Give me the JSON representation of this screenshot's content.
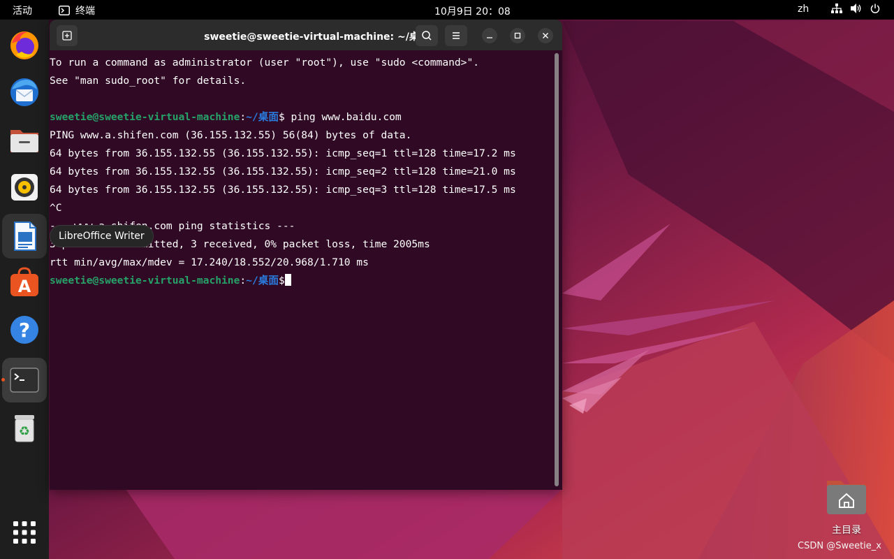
{
  "topbar": {
    "activities": "活动",
    "app_name": "终端",
    "clock": "10月9日  20：08",
    "lang": "zh"
  },
  "dock": {
    "items": [
      {
        "name": "firefox",
        "icon": "firefox-icon"
      },
      {
        "name": "thunderbird",
        "icon": "thunderbird-icon"
      },
      {
        "name": "files",
        "icon": "files-icon"
      },
      {
        "name": "rhythmbox",
        "icon": "rhythmbox-icon"
      },
      {
        "name": "libreoffice-writer",
        "icon": "writer-icon"
      },
      {
        "name": "app-center",
        "icon": "app-center-icon"
      },
      {
        "name": "help",
        "icon": "help-icon"
      },
      {
        "name": "terminal",
        "icon": "terminal-icon",
        "running": true
      },
      {
        "name": "trash",
        "icon": "trash-icon"
      },
      {
        "name": "show-apps",
        "icon": "app-grid-icon"
      }
    ]
  },
  "tooltip": "LibreOffice Writer",
  "terminal": {
    "title": "sweetie@sweetie-virtual-machine: ~/桌面",
    "lines": {
      "l1": "To run a command as administrator (user \"root\"), use \"sudo <command>\".",
      "l2": "See \"man sudo_root\" for details.",
      "prompt_user": "sweetie@sweetie-virtual-machine",
      "prompt_path": "~/桌面",
      "cmd1": " ping www.baidu.com",
      "l4": "PING www.a.shifen.com (36.155.132.55) 56(84) bytes of data.",
      "l5": "64 bytes from 36.155.132.55 (36.155.132.55): icmp_seq=1 ttl=128 time=17.2 ms",
      "l6": "64 bytes from 36.155.132.55 (36.155.132.55): icmp_seq=2 ttl=128 time=21.0 ms",
      "l7": "64 bytes from 36.155.132.55 (36.155.132.55): icmp_seq=3 ttl=128 time=17.5 ms",
      "l8": "^C",
      "l9": "--- www.a.shifen.com ping statistics ---",
      "l10": "3 packets transmitted, 3 received, 0% packet loss, time 2005ms",
      "l11": "rtt min/avg/max/mdev = 17.240/18.552/20.968/1.710 ms"
    }
  },
  "desktop": {
    "home_label": "主目录",
    "watermark": "CSDN @Sweetie_x"
  },
  "colors": {
    "terminal_bg": "#300a24",
    "prompt_user": "#26a269",
    "prompt_path": "#2a7bde",
    "accent": "#e95420"
  }
}
